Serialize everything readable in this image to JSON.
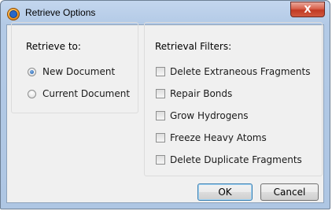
{
  "window": {
    "title": "Retrieve Options",
    "close_label": "X"
  },
  "retrieve_to": {
    "label": "Retrieve to:",
    "options": [
      {
        "label": "New Document",
        "selected": true
      },
      {
        "label": "Current Document",
        "selected": false
      }
    ]
  },
  "filters": {
    "label": "Retrieval Filters:",
    "options": [
      {
        "label": "Delete Extraneous Fragments",
        "checked": false
      },
      {
        "label": "Repair Bonds",
        "checked": false
      },
      {
        "label": "Grow Hydrogens",
        "checked": false
      },
      {
        "label": "Freeze Heavy Atoms",
        "checked": false
      },
      {
        "label": "Delete Duplicate Fragments",
        "checked": false
      }
    ]
  },
  "buttons": {
    "ok": "OK",
    "cancel": "Cancel"
  }
}
